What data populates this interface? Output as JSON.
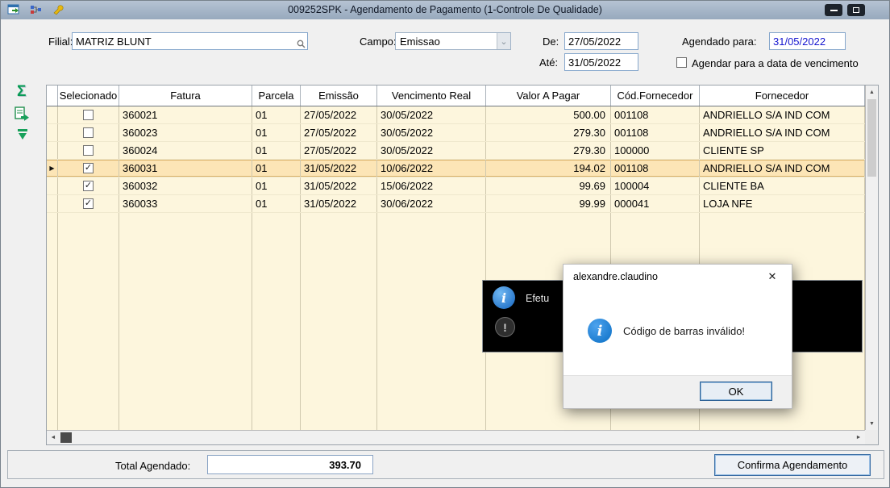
{
  "window": {
    "title": "009252SPK - Agendamento de Pagamento (1-Controle De Qualidade)"
  },
  "form": {
    "filial": {
      "label": "Filial:",
      "value": "MATRIZ BLUNT"
    },
    "campo": {
      "label": "Campo:",
      "value": "Emissao"
    },
    "de": {
      "label": "De:",
      "value": "27/05/2022"
    },
    "ate": {
      "label": "Até:",
      "value": "31/05/2022"
    },
    "agendado": {
      "label": "Agendado para:",
      "value": "31/05/2022"
    },
    "vencimento_option": {
      "label": "Agendar para a data de vencimento",
      "checked": false
    }
  },
  "table": {
    "headers": [
      "Selecionado",
      "Fatura",
      "Parcela",
      "Emissão",
      "Vencimento Real",
      "Valor A Pagar",
      "Cód.Fornecedor",
      "Fornecedor"
    ],
    "rows": [
      {
        "current": false,
        "selected": false,
        "fatura": "360021",
        "parcela": "01",
        "emissao": "27/05/2022",
        "vencimento": "30/05/2022",
        "valor": "500.00",
        "cod": "001108",
        "fornecedor": "ANDRIELLO S/A IND COM"
      },
      {
        "current": false,
        "selected": false,
        "fatura": "360023",
        "parcela": "01",
        "emissao": "27/05/2022",
        "vencimento": "30/05/2022",
        "valor": "279.30",
        "cod": "001108",
        "fornecedor": "ANDRIELLO S/A IND COM"
      },
      {
        "current": false,
        "selected": false,
        "fatura": "360024",
        "parcela": "01",
        "emissao": "27/05/2022",
        "vencimento": "30/05/2022",
        "valor": "279.30",
        "cod": "100000",
        "fornecedor": "CLIENTE SP"
      },
      {
        "current": true,
        "selected": true,
        "fatura": "360031",
        "parcela": "01",
        "emissao": "31/05/2022",
        "vencimento": "10/06/2022",
        "valor": "194.02",
        "cod": "001108",
        "fornecedor": "ANDRIELLO S/A IND COM"
      },
      {
        "current": false,
        "selected": true,
        "fatura": "360032",
        "parcela": "01",
        "emissao": "31/05/2022",
        "vencimento": "15/06/2022",
        "valor": "99.69",
        "cod": "100004",
        "fornecedor": "CLIENTE BA"
      },
      {
        "current": false,
        "selected": true,
        "fatura": "360033",
        "parcela": "01",
        "emissao": "31/05/2022",
        "vencimento": "30/06/2022",
        "valor": "99.99",
        "cod": "000041",
        "fornecedor": "LOJA NFE"
      }
    ]
  },
  "background_window": {
    "message_fragment": "Efetu"
  },
  "dialog": {
    "title": "alexandre.claudino",
    "message": "Código de barras inválido!",
    "ok_label": "OK"
  },
  "footer": {
    "total_label": "Total Agendado:",
    "total_value": "393.70",
    "confirm_label": "Confirma Agendamento"
  },
  "icons": {
    "sigma": "Σ",
    "check": "✓",
    "row_marker": "▶",
    "close": "✕",
    "chevron_down": "⌄",
    "scroll_up": "▲",
    "scroll_down": "▼",
    "scroll_left": "◄",
    "scroll_right": "►",
    "info": "i",
    "exclamation": "!"
  },
  "colors": {
    "accent_blue": "#0a6ec4",
    "grid_bg": "#fdf6dd",
    "row_highlight": "#fce5b6",
    "value_blue": "#1515cf",
    "icon_green": "#089a55"
  }
}
